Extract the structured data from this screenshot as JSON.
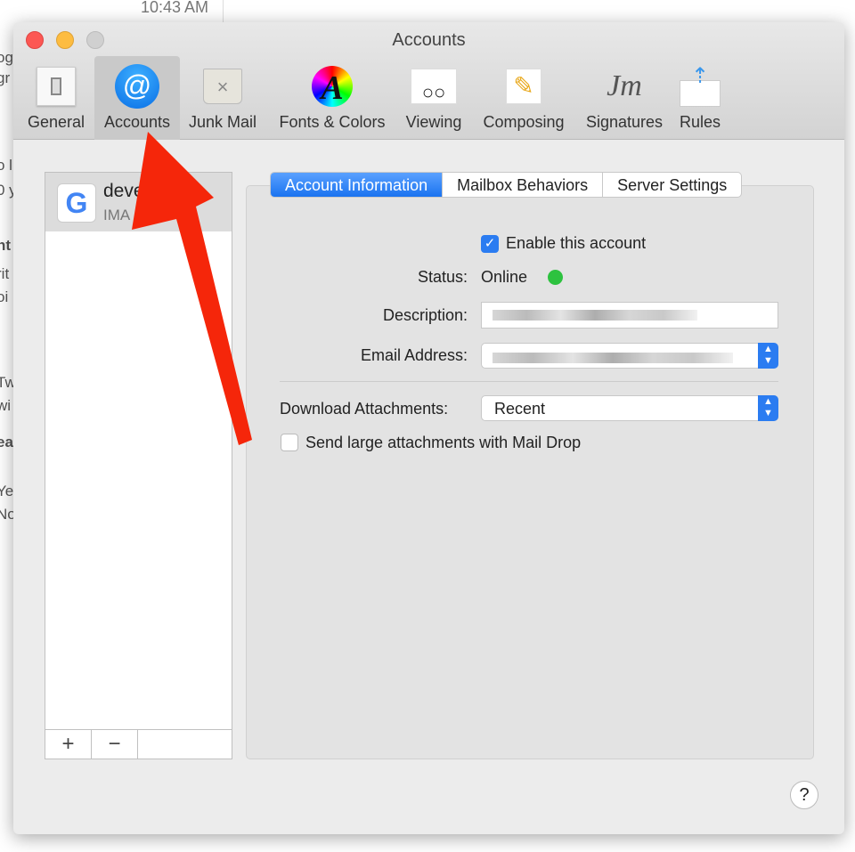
{
  "background": {
    "time": "10:43 AM",
    "fragments": [
      "og",
      "gr",
      "o l",
      "0 y",
      "nt",
      "rit",
      "oi",
      "Tw",
      "wi",
      "ea",
      "Ye",
      "No"
    ]
  },
  "window": {
    "title": "Accounts"
  },
  "toolbar": [
    {
      "label": "General",
      "icon": "switch-icon"
    },
    {
      "label": "Accounts",
      "icon": "at-sign-icon",
      "selected": true
    },
    {
      "label": "Junk Mail",
      "icon": "trash-icon"
    },
    {
      "label": "Fonts & Colors",
      "icon": "color-wheel-font-icon"
    },
    {
      "label": "Viewing",
      "icon": "glasses-icon"
    },
    {
      "label": "Composing",
      "icon": "pencil-icon"
    },
    {
      "label": "Signatures",
      "icon": "signature-icon"
    },
    {
      "label": "Rules",
      "icon": "envelope-arrows-icon"
    }
  ],
  "accounts": [
    {
      "name": "deve",
      "type": "IMA",
      "icon": "google-icon"
    }
  ],
  "list_controls": {
    "add": "+",
    "remove": "−"
  },
  "tabs": [
    {
      "label": "Account Information",
      "active": true
    },
    {
      "label": "Mailbox Behaviors"
    },
    {
      "label": "Server Settings"
    }
  ],
  "form": {
    "enable_label": "Enable this account",
    "enable_checked": true,
    "status_label": "Status:",
    "status_value": "Online",
    "status_color": "#2dc23f",
    "description_label": "Description:",
    "email_label": "Email Address:",
    "download_label": "Download Attachments:",
    "download_value": "Recent",
    "maildrop_label": "Send large attachments with Mail Drop",
    "maildrop_checked": false
  },
  "help": "?",
  "colors": {
    "accent": "#1a73f0",
    "annotation_arrow": "#f5260a"
  }
}
